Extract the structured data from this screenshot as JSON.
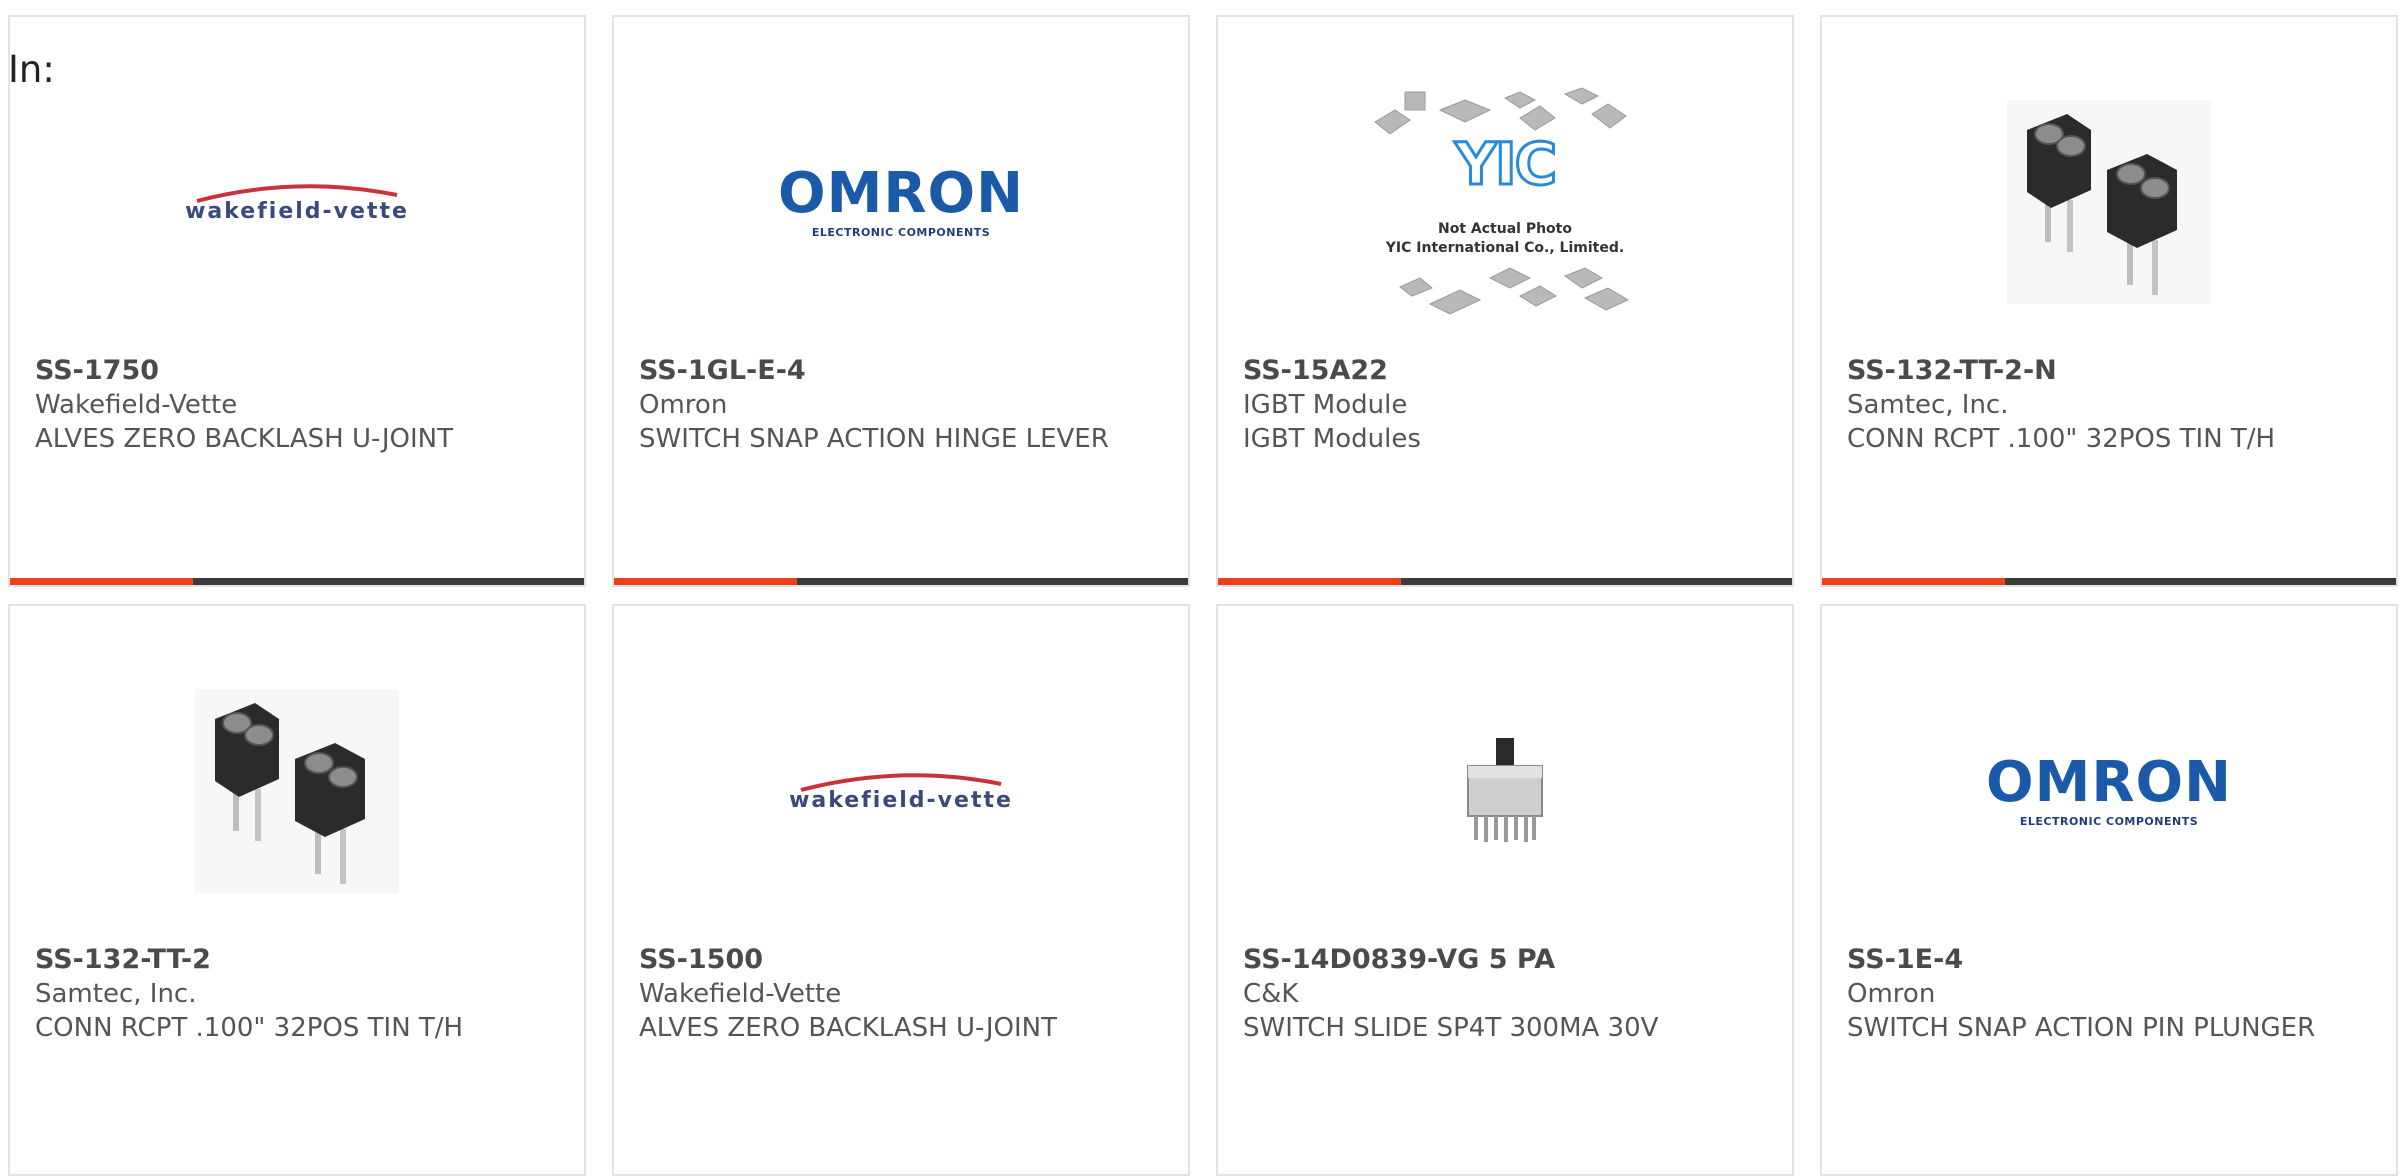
{
  "page": {
    "label": "In:"
  },
  "colors": {
    "accent": "#e8421a",
    "bar": "#3b3b3b",
    "brand_omron": "#1a5aa8",
    "brand_wakefield_arc": "#c8323a",
    "brand_yic": "#2a8ad8"
  },
  "products": [
    {
      "part_number": "SS-1750",
      "manufacturer": "Wakefield-Vette",
      "description": "ALVES ZERO BACKLASH U-JOINT",
      "image": "wakefield-vette-logo",
      "logo_text": "wakefield-vette"
    },
    {
      "part_number": "SS-1GL-E-4",
      "manufacturer": "Omron",
      "description": "SWITCH SNAP ACTION HINGE LEVER",
      "image": "omron-logo",
      "logo_text": "OMRON",
      "logo_sub": "ELECTRONIC COMPONENTS"
    },
    {
      "part_number": "SS-15A22",
      "manufacturer": "IGBT Module",
      "description": "IGBT Modules",
      "image": "yic-placeholder",
      "logo_text": "YIC",
      "caption_1": "Not Actual Photo",
      "caption_2": "YIC International Co., Limited."
    },
    {
      "part_number": "SS-132-TT-2-N",
      "manufacturer": "Samtec, Inc.",
      "description": "CONN RCPT .100\" 32POS TIN T/H",
      "image": "connector-photo"
    },
    {
      "part_number": "SS-132-TT-2",
      "manufacturer": "Samtec, Inc.",
      "description": "CONN RCPT .100\" 32POS TIN T/H",
      "image": "connector-photo"
    },
    {
      "part_number": "SS-1500",
      "manufacturer": "Wakefield-Vette",
      "description": "ALVES ZERO BACKLASH U-JOINT",
      "image": "wakefield-vette-logo",
      "logo_text": "wakefield-vette"
    },
    {
      "part_number": "SS-14D0839-VG 5 PA",
      "manufacturer": "C&K",
      "description": "SWITCH SLIDE SP4T 300MA 30V",
      "image": "slide-switch-photo"
    },
    {
      "part_number": "SS-1E-4",
      "manufacturer": "Omron",
      "description": "SWITCH SNAP ACTION PIN PLUNGER",
      "image": "omron-logo",
      "logo_text": "OMRON",
      "logo_sub": "ELECTRONIC COMPONENTS"
    }
  ]
}
